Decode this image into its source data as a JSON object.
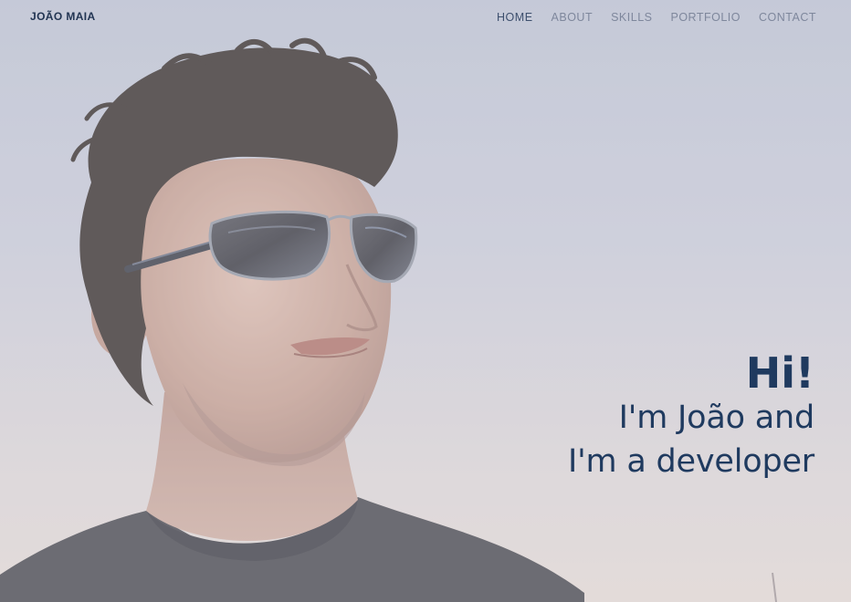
{
  "brand": {
    "name": "JOÃO MAIA"
  },
  "nav": {
    "items": [
      {
        "label": "HOME",
        "active": true
      },
      {
        "label": "ABOUT",
        "active": false
      },
      {
        "label": "SKILLS",
        "active": false
      },
      {
        "label": "PORTFOLIO",
        "active": false
      },
      {
        "label": "CONTACT",
        "active": false
      }
    ]
  },
  "hero": {
    "greeting": "Hi!",
    "line1": "I'm João and",
    "line2": "I'm a developer",
    "text_color": "#1f3a5f",
    "photo_icon": "portrait-photo"
  },
  "colors": {
    "nav_active": "#3d4f6d",
    "nav_inactive": "#7e879c",
    "sky_top": "#b6bccd",
    "sky_bottom": "#e0d5cf"
  }
}
